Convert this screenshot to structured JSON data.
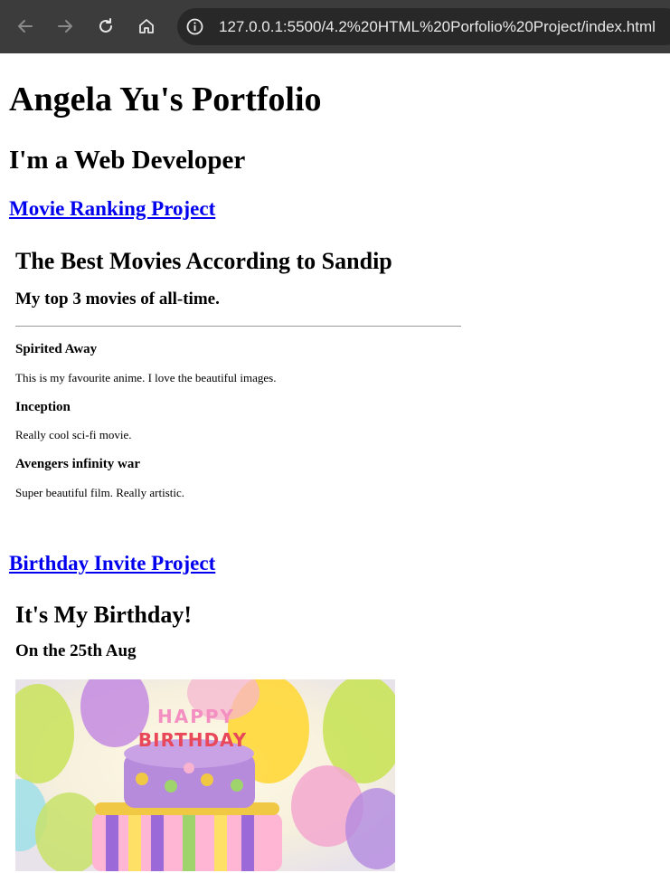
{
  "browser": {
    "url": "127.0.0.1:5500/4.2%20HTML%20Porfolio%20Project/index.html",
    "icons": [
      "back-icon",
      "forward-icon",
      "reload-icon",
      "home-icon",
      "info-icon"
    ]
  },
  "portfolio": {
    "title": "Angela Yu's Portfolio",
    "subtitle": "I'm a Web Developer"
  },
  "projects": {
    "movie": {
      "link": "Movie Ranking Project",
      "title": "The Best Movies According to Sandip",
      "subtitle": "My top 3 movies of all-time.",
      "movies": [
        {
          "name": "Spirited Away",
          "desc": "This is my favourite anime. I love the beautiful images."
        },
        {
          "name": "Inception",
          "desc": "Really cool sci-fi movie."
        },
        {
          "name": "Avengers infinity war",
          "desc": "Super beautiful film. Really artistic."
        }
      ]
    },
    "birthday": {
      "link": "Birthday Invite Project",
      "title": "It's My Birthday!",
      "subtitle": "On the 25th Aug",
      "image_letters_top": "HAPPY",
      "image_letters_bottom": "BIRTHDAY"
    }
  }
}
